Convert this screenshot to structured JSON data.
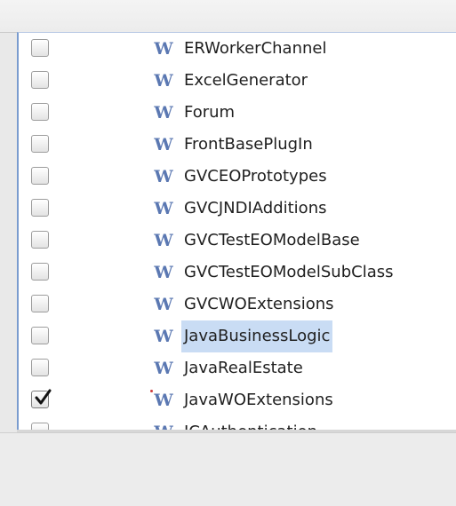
{
  "frameworks": {
    "items": [
      {
        "label": "ERWorkerChannel",
        "checked": false,
        "selected": false,
        "icon": "framework-w-icon"
      },
      {
        "label": "ExcelGenerator",
        "checked": false,
        "selected": false,
        "icon": "framework-w-icon"
      },
      {
        "label": "Forum",
        "checked": false,
        "selected": false,
        "icon": "framework-w-icon"
      },
      {
        "label": "FrontBasePlugIn",
        "checked": false,
        "selected": false,
        "icon": "framework-w-icon"
      },
      {
        "label": "GVCEOPrototypes",
        "checked": false,
        "selected": false,
        "icon": "framework-w-icon"
      },
      {
        "label": "GVCJNDIAdditions",
        "checked": false,
        "selected": false,
        "icon": "framework-w-icon"
      },
      {
        "label": "GVCTestEOModelBase",
        "checked": false,
        "selected": false,
        "icon": "framework-w-icon"
      },
      {
        "label": "GVCTestEOModelSubClass",
        "checked": false,
        "selected": false,
        "icon": "framework-w-icon"
      },
      {
        "label": "GVCWOExtensions",
        "checked": false,
        "selected": false,
        "icon": "framework-w-icon"
      },
      {
        "label": "JavaBusinessLogic",
        "checked": false,
        "selected": true,
        "icon": "framework-w-icon"
      },
      {
        "label": "JavaRealEstate",
        "checked": false,
        "selected": false,
        "icon": "framework-w-icon"
      },
      {
        "label": "JavaWOExtensions",
        "checked": true,
        "selected": false,
        "icon": "framework-w-icon"
      },
      {
        "label": "JCAuthentication",
        "checked": false,
        "selected": false,
        "icon": "framework-w-icon"
      }
    ],
    "icon_glyph": "W",
    "colors": {
      "selection": "#c9dcf4",
      "icon": "#5b78b2",
      "focus_border": "#7a9ccf"
    }
  }
}
